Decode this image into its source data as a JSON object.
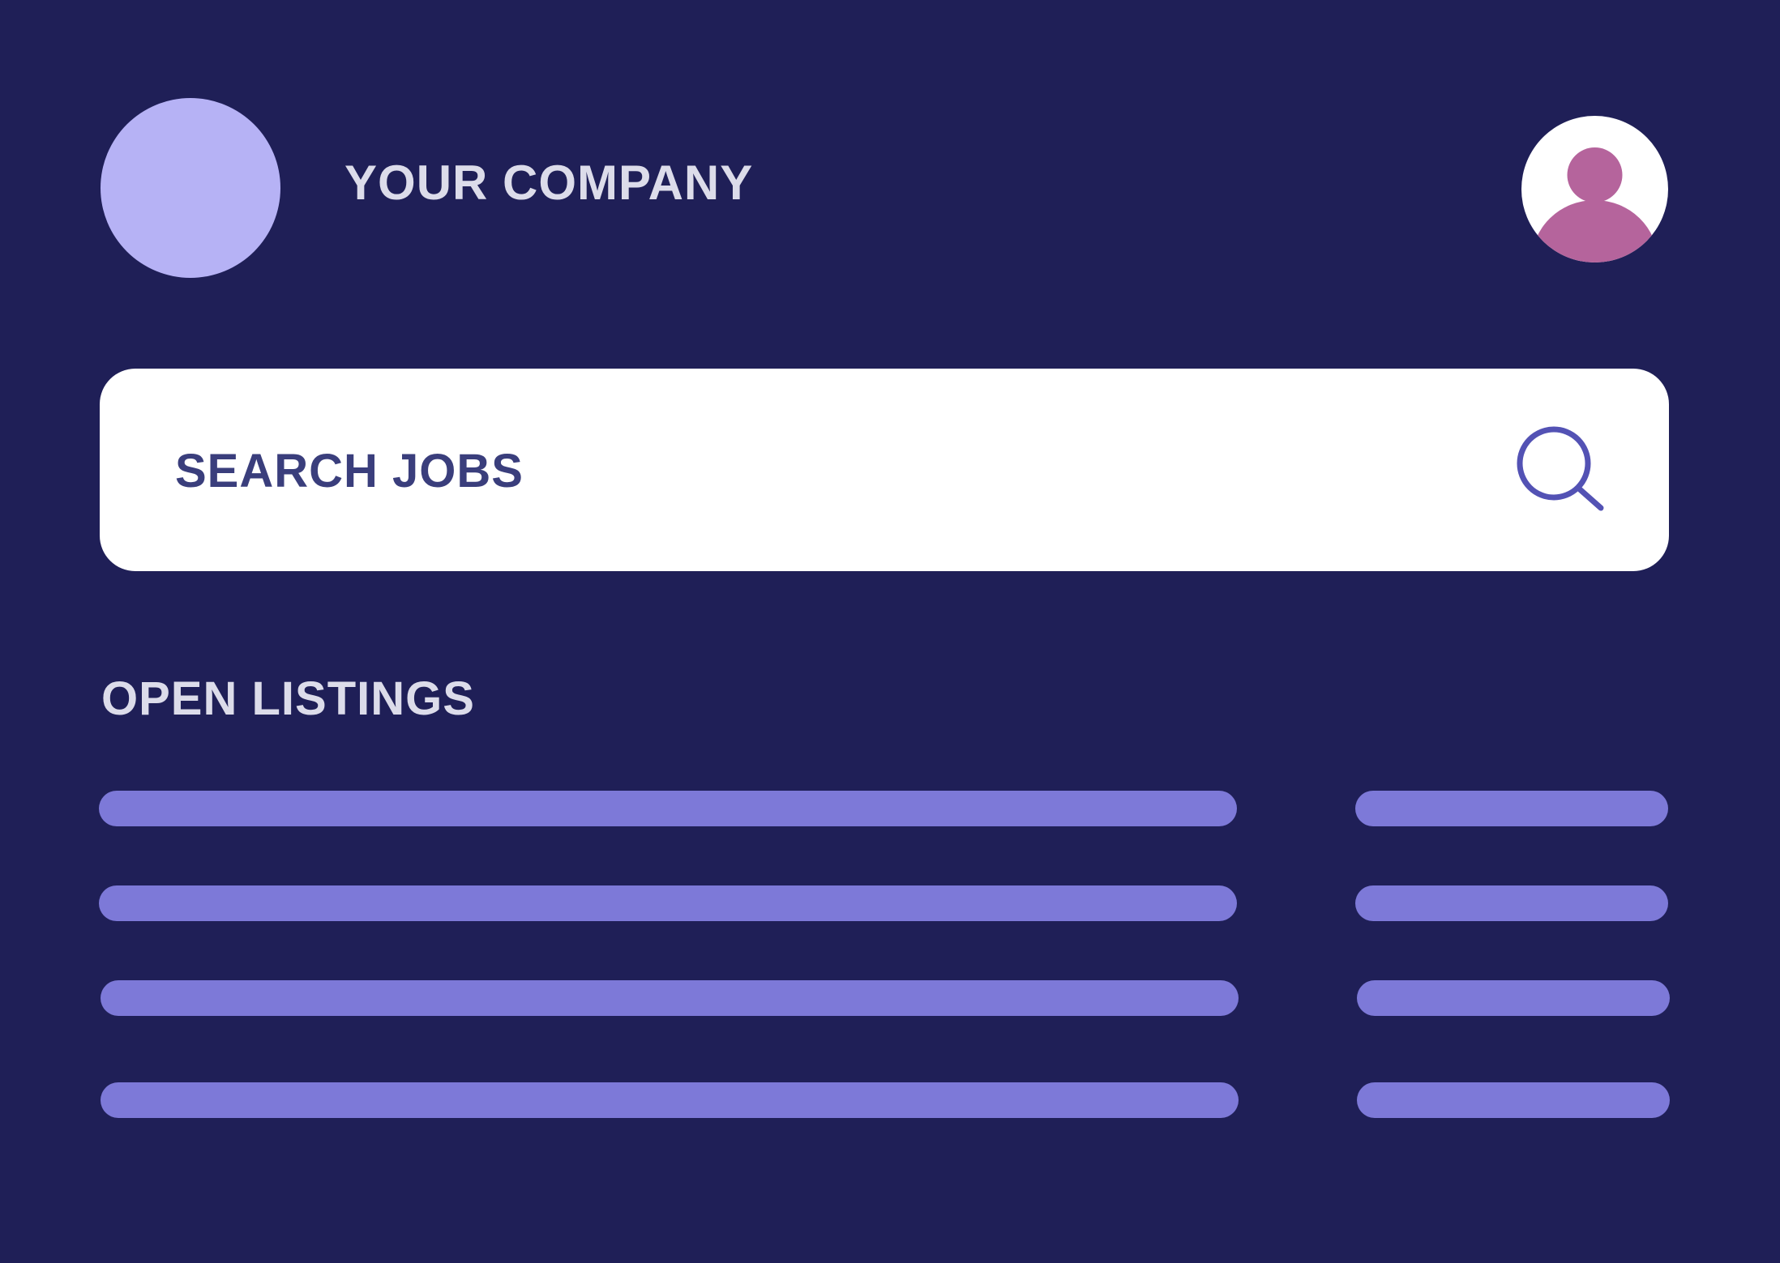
{
  "header": {
    "company_name": "YOUR COMPANY",
    "logo_color": "#b6b2f5",
    "avatar_icon": "user-avatar-icon",
    "avatar_color": "#b5649c"
  },
  "search": {
    "placeholder": "SEARCH JOBS",
    "icon": "search-icon",
    "icon_color": "#5352b4"
  },
  "listings": {
    "title": "OPEN LISTINGS",
    "bar_color": "#7d79d8",
    "row_count": 4
  },
  "colors": {
    "background": "#1f1f57",
    "text_light": "#dcdcea",
    "text_dark": "#3a3e7c"
  }
}
